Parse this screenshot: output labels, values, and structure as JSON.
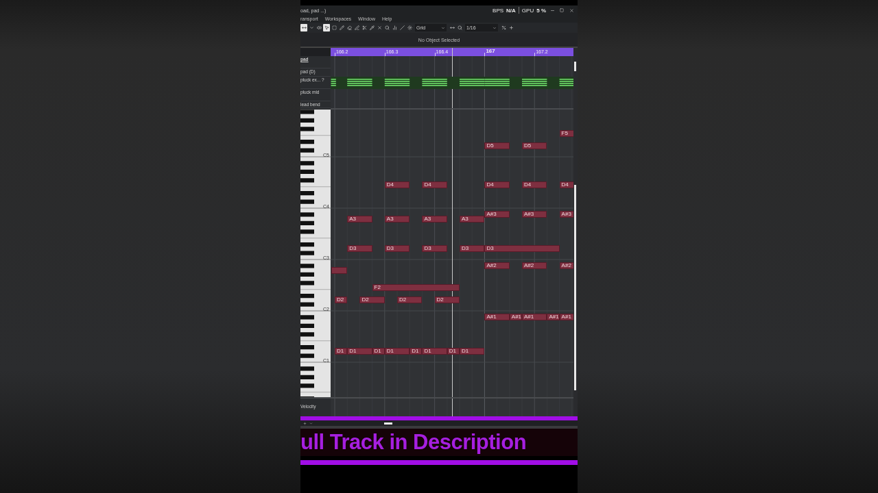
{
  "window": {
    "title": "oad, pad ...)",
    "bps_label": "BPS",
    "bps_value": "N/A",
    "gpu_label": "GPU",
    "gpu_value": "5 %"
  },
  "menu": [
    "ransport",
    "Workspaces",
    "Window",
    "Help"
  ],
  "toolbar": {
    "tools": [
      {
        "kind": "arrows",
        "selected": true
      },
      {
        "kind": "caret",
        "selected": false
      },
      {
        "kind": "speaker",
        "selected": false
      },
      {
        "kind": "pointer",
        "selected": true
      },
      {
        "kind": "range",
        "selected": false
      },
      {
        "kind": "pencil",
        "selected": false
      },
      {
        "kind": "eraser",
        "selected": false
      },
      {
        "kind": "line",
        "selected": false
      },
      {
        "kind": "scissors",
        "selected": false
      },
      {
        "kind": "pipette",
        "selected": false
      },
      {
        "kind": "mute",
        "selected": false
      },
      {
        "kind": "zoom",
        "selected": false
      },
      {
        "kind": "bars",
        "selected": false
      },
      {
        "kind": "slash",
        "selected": false
      }
    ],
    "snap": {
      "value": "Grid"
    },
    "quantize": {
      "value": "1/16"
    }
  },
  "info_line": "No Object Selected",
  "ruler": {
    "marks": [
      {
        "label": "166.2",
        "kind": "beat"
      },
      {
        "label": "166.3",
        "kind": "beat"
      },
      {
        "label": "166.4",
        "kind": "beat"
      },
      {
        "label": "167",
        "kind": "bar"
      },
      {
        "label": "167.2",
        "kind": "beat"
      }
    ]
  },
  "tracks": [
    {
      "name": "pad",
      "kind": "header"
    },
    {
      "name": "pad (D)",
      "kind": "track"
    },
    {
      "name": "pluck ex... ?",
      "kind": "part"
    },
    {
      "name": "pluck mid",
      "kind": "track"
    },
    {
      "name": "lead bend",
      "kind": "track"
    }
  ],
  "keyboard": {
    "labels": [
      "C5",
      "C4",
      "C3",
      "C2",
      "C1"
    ]
  },
  "notes": [
    {
      "kind": "labeled",
      "label": "F5"
    },
    {
      "kind": "labeled",
      "label": "D5"
    },
    {
      "kind": "labeled",
      "label": "D5"
    },
    {
      "kind": "labeled",
      "label": "D4"
    },
    {
      "kind": "labeled",
      "label": "D4"
    },
    {
      "kind": "labeled",
      "label": "D4"
    },
    {
      "kind": "labeled",
      "label": "D4"
    },
    {
      "kind": "labeled",
      "label": "D4"
    },
    {
      "kind": "labeled",
      "label": "A#3"
    },
    {
      "kind": "labeled",
      "label": "A#3"
    },
    {
      "kind": "labeled",
      "label": "A#3"
    },
    {
      "kind": "labeled",
      "label": "A3"
    },
    {
      "kind": "labeled",
      "label": "A3"
    },
    {
      "kind": "labeled",
      "label": "A3"
    },
    {
      "kind": "labeled",
      "label": "A3"
    },
    {
      "kind": "labeled",
      "label": "D3"
    },
    {
      "kind": "labeled",
      "label": "D3"
    },
    {
      "kind": "labeled",
      "label": "D3"
    },
    {
      "kind": "labeled",
      "label": "D3"
    },
    {
      "kind": "labeled",
      "label": "D3"
    },
    {
      "kind": "labeled",
      "label": "A#2"
    },
    {
      "kind": "labeled",
      "label": "A#2"
    },
    {
      "kind": "labeled",
      "label": "A#2"
    },
    {
      "kind": "blank"
    },
    {
      "kind": "labeled",
      "label": "F2"
    },
    {
      "kind": "labeled",
      "label": "D2"
    },
    {
      "kind": "labeled",
      "label": "D2"
    },
    {
      "kind": "labeled",
      "label": "D2"
    },
    {
      "kind": "labeled",
      "label": "D2"
    },
    {
      "kind": "labeled",
      "label": "A#1"
    },
    {
      "kind": "labeled",
      "label": "A#1"
    },
    {
      "kind": "labeled",
      "label": "A#1"
    },
    {
      "kind": "labeled",
      "label": "A#1"
    },
    {
      "kind": "labeled",
      "label": "A#1"
    },
    {
      "kind": "labeled",
      "label": "D1"
    },
    {
      "kind": "labeled",
      "label": "D1"
    },
    {
      "kind": "labeled",
      "label": "D1"
    },
    {
      "kind": "labeled",
      "label": "D1"
    },
    {
      "kind": "labeled",
      "label": "D1"
    },
    {
      "kind": "labeled",
      "label": "D1"
    },
    {
      "kind": "labeled",
      "label": "D1"
    },
    {
      "kind": "labeled",
      "label": "D1"
    }
  ],
  "velocity_lane": {
    "label": "Velocity"
  },
  "caption": "ull Track in Description"
}
